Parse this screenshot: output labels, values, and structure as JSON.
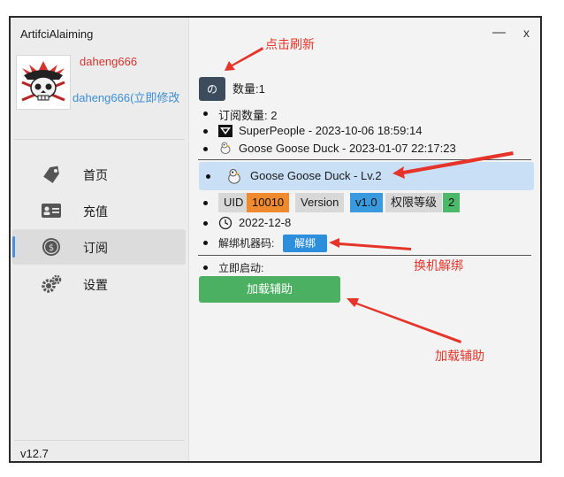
{
  "window": {
    "title": "ArtifciAlaiming",
    "minimize_glyph": "—",
    "close_glyph": "x"
  },
  "profile": {
    "username": "daheng666",
    "edit_link": "daheng666(立即修改"
  },
  "sidebar": {
    "items": [
      {
        "label": "首页",
        "icon": "tag-icon"
      },
      {
        "label": "充值",
        "icon": "id-card-icon"
      },
      {
        "label": "订阅",
        "icon": "coin-icon",
        "active": true
      },
      {
        "label": "设置",
        "icon": "gears-icon"
      }
    ],
    "version": "v12.7"
  },
  "main": {
    "refresh_glyph": "の",
    "count": "数量:1",
    "subscription_count": "订阅数量: 2",
    "subscriptions": [
      {
        "text": "SuperPeople - 2023-10-06 18:59:14",
        "icon": "superpeople-icon"
      },
      {
        "text": "Goose Goose Duck - 2023-01-07 22:17:23",
        "icon": "goose-icon"
      }
    ],
    "selected": {
      "text": "Goose Goose Duck - Lv.2",
      "icon": "goose-icon"
    },
    "tags": {
      "uid_label": "UID",
      "uid_value": "10010",
      "version_label": "Version",
      "version_value": "v1.0",
      "level_label": "权限等级",
      "level_value": "2"
    },
    "expiry_date": "2022-12-8",
    "unbind_label": "解绑机器码:",
    "unbind_button": "解绑",
    "launch_label": "立即启动:",
    "load_button": "加载辅助"
  },
  "annotations": {
    "refresh": "点击刷新",
    "unbind": "换机解绑",
    "load": "加载辅助"
  },
  "colors": {
    "annotation": "#e5352a",
    "accent_blue": "#2d8fdc",
    "load_green": "#4bb062",
    "uid_orange": "#f08a2e",
    "selected_row": "#c9dff6",
    "username_red": "#d8322c"
  }
}
